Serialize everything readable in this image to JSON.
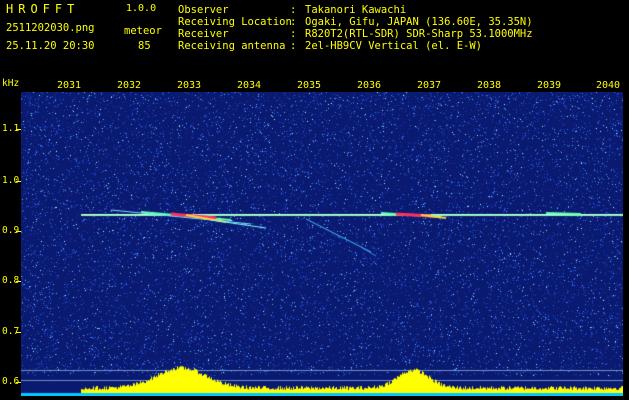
{
  "header": {
    "app_name": "HROFFT",
    "version": "1.0.0",
    "filename": "2511202030.png",
    "meteor_label": "meteor",
    "datetime": "25.11.20 20:30",
    "meteor_count": "85",
    "fields": [
      {
        "label": "Observer",
        "value": "Takanori Kawachi"
      },
      {
        "label": "Receiving Location",
        "value": "Ogaki, Gifu, JAPAN (136.60E, 35.35N)"
      },
      {
        "label": "Receiver",
        "value": "R820T2(RTL-SDR) SDR-Sharp 53.1000MHz"
      },
      {
        "label": "Receiving antenna",
        "value": "2el-HB9CV Vertical (el. E-W)"
      }
    ],
    "separator": ":"
  },
  "time_axis": {
    "labels": [
      "2031",
      "2032",
      "2033",
      "2034",
      "2035",
      "2036",
      "2037",
      "2038",
      "2039",
      "2040"
    ]
  },
  "freq_axis": {
    "unit": "kHz",
    "labels": [
      "1.1",
      "1.0",
      "0.9",
      "0.8",
      "0.7",
      "0.6"
    ],
    "range_khz": [
      0.58,
      1.16
    ]
  },
  "colors": {
    "text": "#ffff00",
    "background": "#000000",
    "noise_base": "#0a1a70",
    "carrier": "#7fffaa",
    "echo_core": "#ff3060",
    "meter": "#ffff00",
    "meter_base": "#00c8ff"
  }
}
